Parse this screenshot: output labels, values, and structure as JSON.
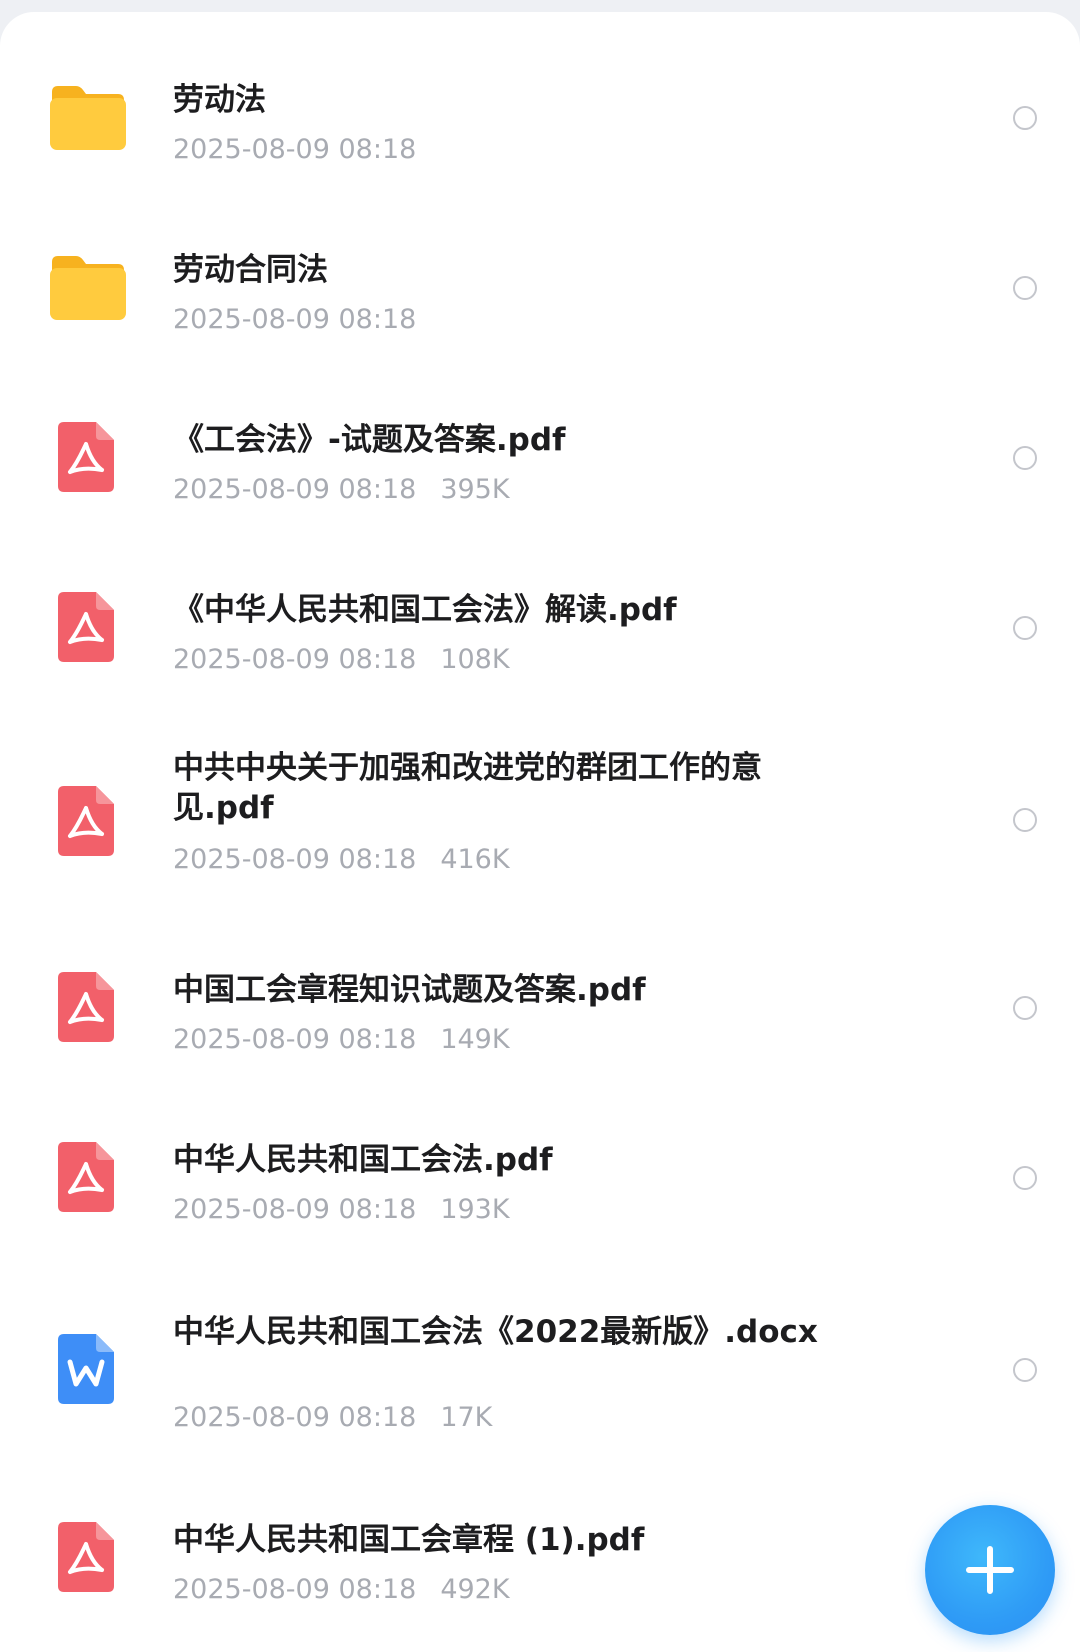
{
  "files": [
    {
      "type": "folder",
      "name": "劳动法",
      "date": "2025-08-09 08:18",
      "size": ""
    },
    {
      "type": "folder",
      "name": "劳动合同法",
      "date": "2025-08-09 08:18",
      "size": ""
    },
    {
      "type": "pdf",
      "name": "《工会法》-试题及答案.pdf",
      "date": "2025-08-09 08:18",
      "size": "395K"
    },
    {
      "type": "pdf",
      "name": "《中华人民共和国工会法》解读.pdf",
      "date": "2025-08-09 08:18",
      "size": "108K"
    },
    {
      "type": "pdf",
      "name": "中共中央关于加强和改进党的群团工作的意见.pdf",
      "date": "2025-08-09 08:18",
      "size": "416K"
    },
    {
      "type": "pdf",
      "name": "中国工会章程知识试题及答案.pdf",
      "date": "2025-08-09 08:18",
      "size": "149K"
    },
    {
      "type": "pdf",
      "name": "中华人民共和国工会法.pdf",
      "date": "2025-08-09 08:18",
      "size": "193K"
    },
    {
      "type": "docx",
      "name": "中华人民共和国工会法《2022最新版》.docx",
      "date": "2025-08-09 08:18",
      "size": "17K"
    },
    {
      "type": "pdf",
      "name": "中华人民共和国工会章程 (1).pdf",
      "date": "2025-08-09 08:18",
      "size": "492K"
    }
  ],
  "colors": {
    "folder": "#FFC83D",
    "pdf": "#F2606A",
    "docx": "#3E8EF7",
    "fab": "#2F9CF6"
  },
  "icons": {
    "folder": "folder-icon",
    "pdf": "pdf-icon",
    "docx": "word-doc-icon",
    "fab": "plus-icon"
  }
}
